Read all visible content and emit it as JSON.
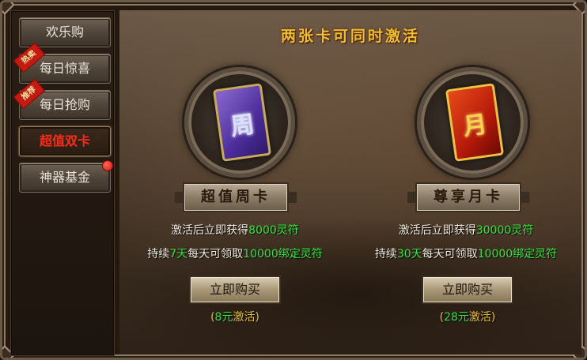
{
  "sidebar": {
    "items": [
      {
        "label": "欢乐购",
        "badge": ""
      },
      {
        "label": "每日惊喜",
        "badge": "热卖"
      },
      {
        "label": "每日抢购",
        "badge": "推荐"
      },
      {
        "label": "超值双卡",
        "badge": "",
        "active": true
      },
      {
        "label": "神器基金",
        "badge": "",
        "dot": true
      }
    ]
  },
  "main": {
    "title": "两张卡可同时激活",
    "cards": [
      {
        "card_glyph": "周",
        "name": "超值周卡",
        "line1_pre": "激活后立即获得",
        "line1_val": "8000灵符",
        "line2_pre": "持续",
        "line2_days": "7天",
        "line2_mid": "每天可领取",
        "line2_val": "10000绑定灵符",
        "buy_label": "立即购买",
        "price_open": "(",
        "price_val": "8元",
        "price_close": "激活)"
      },
      {
        "card_glyph": "月",
        "name": "尊享月卡",
        "line1_pre": "激活后立即获得",
        "line1_val": "30000灵符",
        "line2_pre": "持续",
        "line2_days": "30天",
        "line2_mid": "每天可领取",
        "line2_val": "10000绑定灵符",
        "buy_label": "立即购买",
        "price_open": "(",
        "price_val": "28元",
        "price_close": "激活)"
      }
    ]
  },
  "colors": {
    "accent_green": "#34e63a",
    "title_gold": "#e8c030",
    "active_red": "#ff2a1a",
    "hot_ribbon": "#c41a12"
  },
  "icons": {
    "week_card": "purple-card-icon",
    "month_card": "gold-dragon-card-icon",
    "notification": "red-dot-icon"
  }
}
